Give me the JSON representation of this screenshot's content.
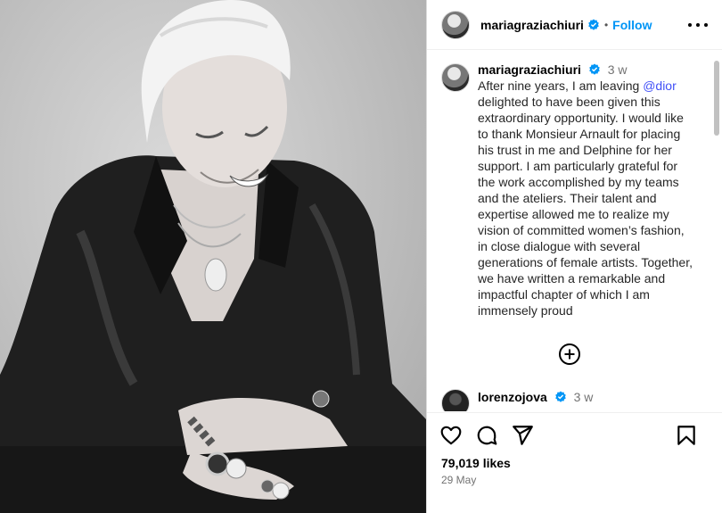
{
  "post": {
    "username": "mariagraziachiuri",
    "follow_label": "Follow",
    "separator": "•",
    "verified_icon": "verified-badge-icon",
    "more_icon": "more-options-icon"
  },
  "caption": {
    "username": "mariagraziachiuri",
    "time": "3 w",
    "text_before_mention": "After nine years, I am leaving ",
    "mention": "@dior",
    "text_after_mention": " delighted to have been given this extraordinary opportunity. I would like to thank Monsieur Arnault for placing his trust in me and Delphine for her support. I am particularly grateful for the work accomplished by my teams and the ateliers. Their talent and expertise allowed me to realize my vision of committed women’s fashion, in close dialogue with several generations of female artists. Together, we have written a remarkable and impactful chapter of which I am immensely proud"
  },
  "load_more_icon": "plus-circle-icon",
  "comment2": {
    "username": "lorenzojova",
    "time": "3 w"
  },
  "actions": {
    "like_icon": "heart-icon",
    "comment_icon": "comment-icon",
    "share_icon": "send-icon",
    "save_icon": "bookmark-icon",
    "likes": "79,019 likes",
    "date": "29 May"
  },
  "colors": {
    "follow": "#0095f6",
    "verified": "#0095f6",
    "mention": "#4150f7"
  }
}
